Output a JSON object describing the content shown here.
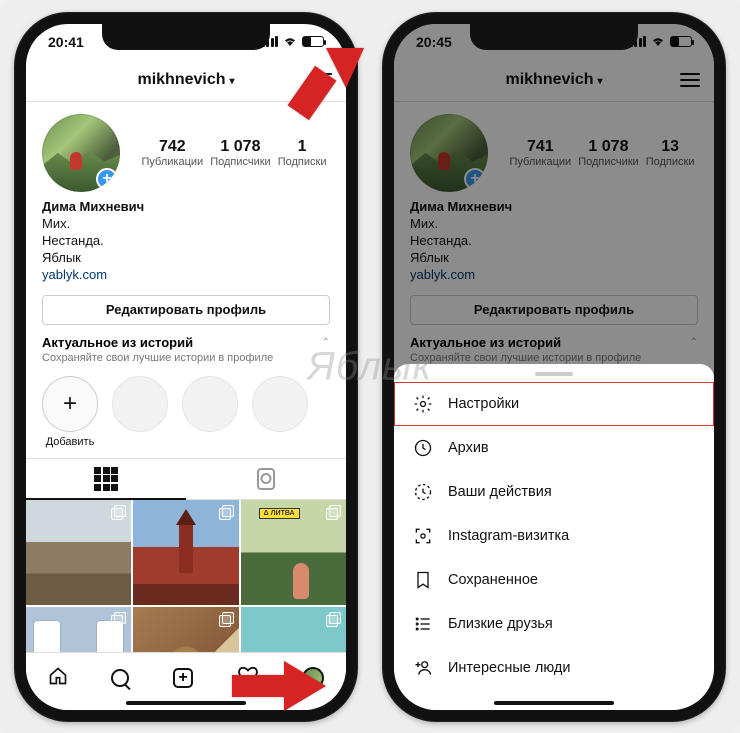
{
  "watermark": "Яблык",
  "left": {
    "status": {
      "time": "20:41"
    },
    "header": {
      "username": "mikhnevich"
    },
    "stats": {
      "posts_num": "742",
      "posts_lbl": "Публикации",
      "followers_num": "1 078",
      "followers_lbl": "Подписчики",
      "following_num": "1",
      "following_lbl": "Подписки"
    },
    "bio": {
      "name": "Дима Михневич",
      "line1": "Мих.",
      "line2": "Нестанда.",
      "line3": "Яблык",
      "link": "yablyk.com"
    },
    "edit_btn": "Редактировать профиль",
    "highlights": {
      "title": "Актуальное из историй",
      "subtitle": "Сохраняйте свои лучшие истории в профиле",
      "add": "Добавить"
    }
  },
  "right": {
    "status": {
      "time": "20:45"
    },
    "header": {
      "username": "mikhnevich"
    },
    "stats": {
      "posts_num": "741",
      "posts_lbl": "Публикации",
      "followers_num": "1 078",
      "followers_lbl": "Подписчики",
      "following_num": "13",
      "following_lbl": "Подписки"
    },
    "bio": {
      "name": "Дима Михневич",
      "line1": "Мих.",
      "line2": "Нестанда.",
      "line3": "Яблык",
      "link": "yablyk.com"
    },
    "edit_btn": "Редактировать профиль",
    "highlights": {
      "title": "Актуальное из историй",
      "subtitle": "Сохраняйте свои лучшие истории в профиле"
    },
    "sheet": {
      "settings": "Настройки",
      "archive": "Архив",
      "activity": "Ваши действия",
      "nametag": "Instagram-визитка",
      "saved": "Сохраненное",
      "close_friends": "Близкие друзья",
      "discover": "Интересные люди"
    }
  }
}
